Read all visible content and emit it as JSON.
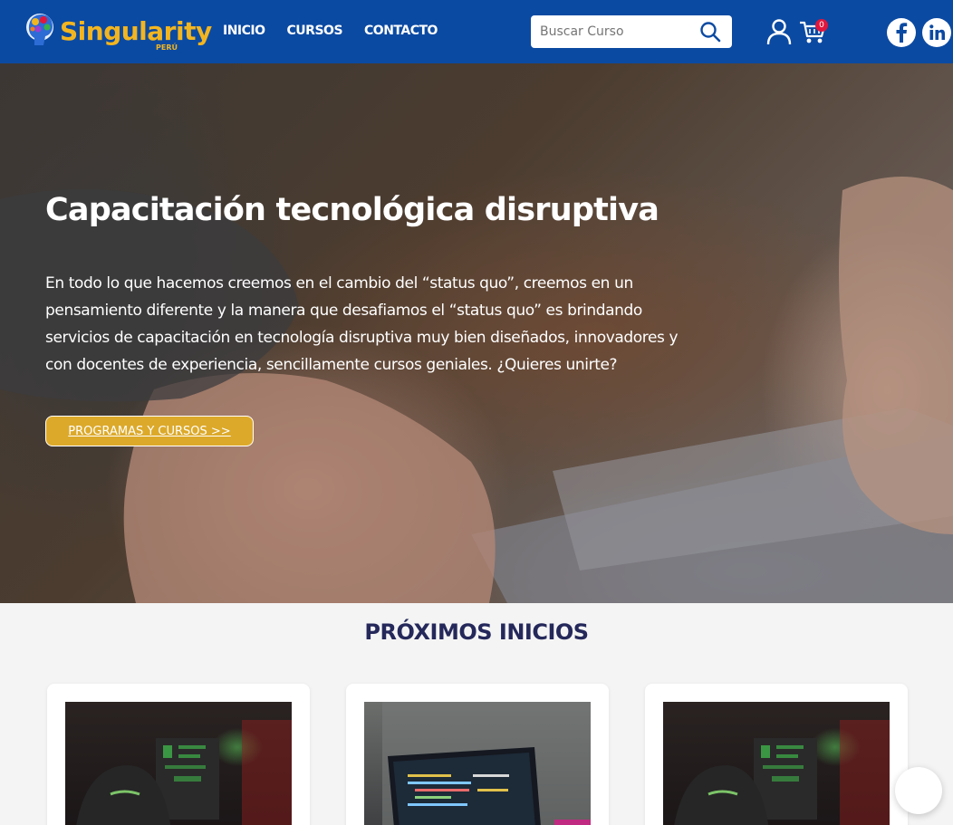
{
  "header": {
    "logo_text": "Singularity",
    "logo_sub": "PERÚ",
    "nav": [
      {
        "label": "INICIO"
      },
      {
        "label": "CURSOS"
      },
      {
        "label": "CONTACTO"
      }
    ],
    "search": {
      "placeholder": "Buscar Curso",
      "value": ""
    },
    "cart_count": "0",
    "icons": [
      "search-icon",
      "user-icon",
      "cart-icon",
      "facebook-icon",
      "linkedin-icon"
    ],
    "colors": {
      "header_bg": "#0b4aa2",
      "brand": "#f3b51f",
      "badge": "#e1163c"
    }
  },
  "hero": {
    "title": "Capacitación tecnológica disruptiva",
    "text": "En todo lo que hacemos creemos en el cambio del “status quo”, creemos en un pensamiento diferente y la manera que desafiamos el “status quo” es brindando servicios de capacitación en tecnología disruptiva muy bien diseñados, innovadores y con docentes de experiencia, sencillamente cursos geniales. ¿Quieres unirte?",
    "button_label": "PROGRAMAS Y CURSOS >>",
    "colors": {
      "button": "#dca92a"
    }
  },
  "proximos": {
    "title": "PRÓXIMOS INICIOS",
    "title_color": "#24285a"
  }
}
